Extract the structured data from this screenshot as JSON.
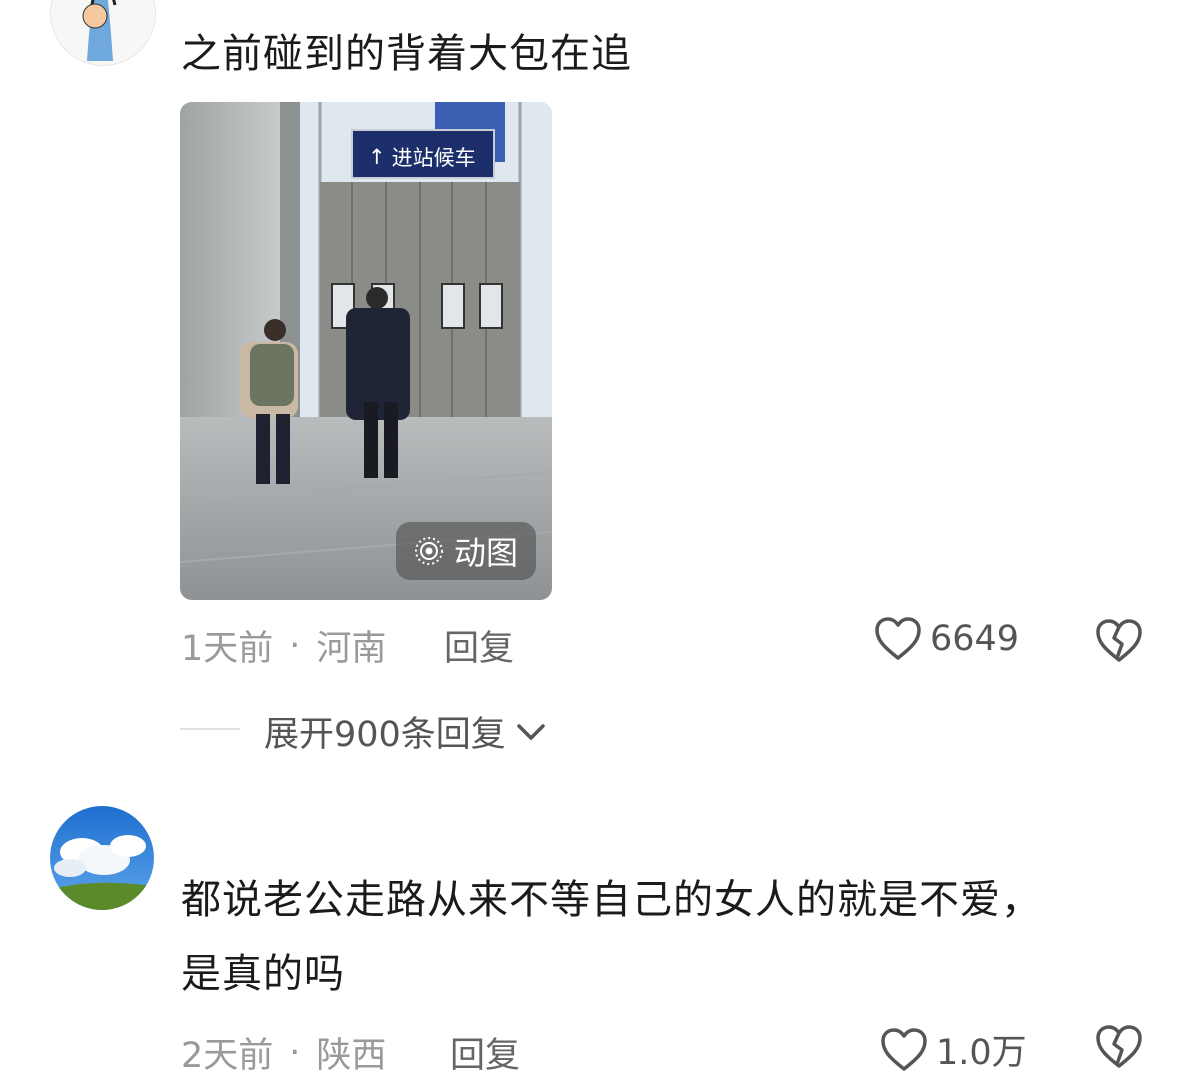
{
  "comments": [
    {
      "text": "之前碰到的背着大包在追",
      "image": {
        "sign_text": "进站候车",
        "badge_label": "动图"
      },
      "time": "1天前",
      "location": "河南",
      "separator": "·",
      "reply_label": "回复",
      "likes": "6649",
      "expand_label": "展开900条回复"
    },
    {
      "text_line1": "都说老公走路从来不等自己的女人的就是不爱，",
      "text_line2": "是真的吗",
      "time": "2天前",
      "location": "陕西",
      "separator": "·",
      "reply_label": "回复",
      "likes": "1.0万"
    }
  ],
  "icons": [
    "heart-outline-icon",
    "broken-heart-icon",
    "chevron-down-icon",
    "live-photo-icon"
  ],
  "colors": {
    "text": "#1b1b1b",
    "meta": "#9a9a9a",
    "icon": "#555555"
  }
}
